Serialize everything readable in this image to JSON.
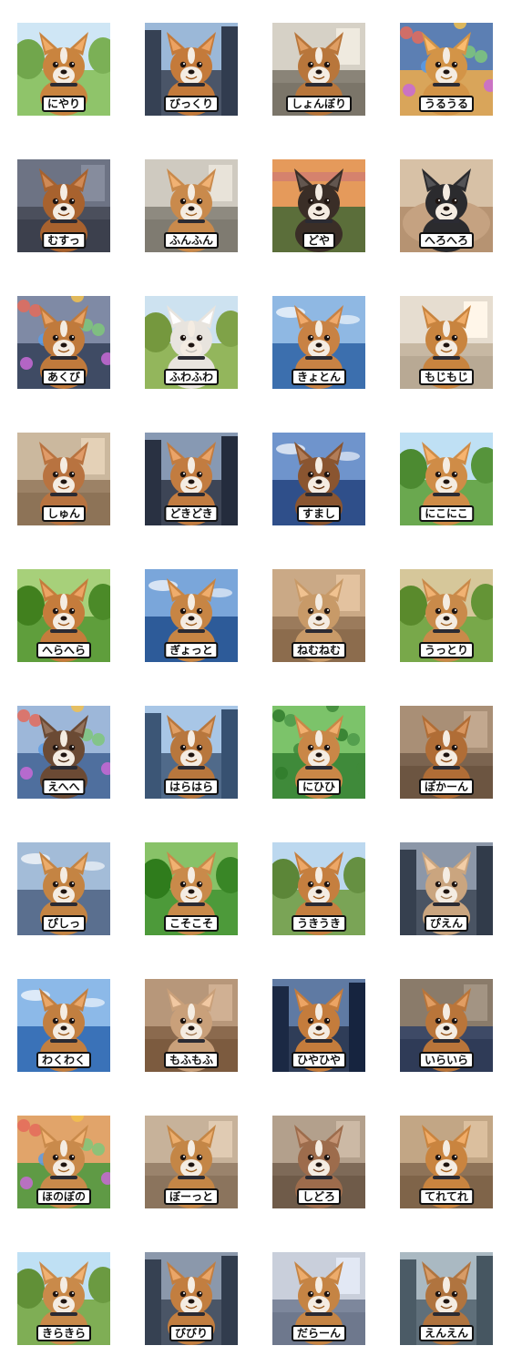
{
  "stickers": [
    {
      "label": "にやり",
      "scene": "park",
      "bg": "#8fc46a",
      "sky": "#cfe6f5",
      "dog": "#c9843f"
    },
    {
      "label": "びっくり",
      "scene": "city",
      "bg": "#4a5568",
      "sky": "#9bb8d8",
      "dog": "#c47a3a"
    },
    {
      "label": "しょんぼり",
      "scene": "room",
      "bg": "#8a8478",
      "sky": "#d6d1c6",
      "dog": "#b8763b"
    },
    {
      "label": "うるうる",
      "scene": "toys",
      "bg": "#d9a55a",
      "sky": "#5c7fb3",
      "dog": "#d39447"
    },
    {
      "label": "むすっ",
      "scene": "sofa",
      "bg": "#4b4f5c",
      "sky": "#6d7384",
      "dog": "#a8622e"
    },
    {
      "label": "ふんふん",
      "scene": "room",
      "bg": "#8e8a80",
      "sky": "#cfcac0",
      "dog": "#c98a4c"
    },
    {
      "label": "どや",
      "scene": "sunset",
      "bg": "#5b6e3a",
      "sky": "#e59a5b",
      "dog": "#3a2e27"
    },
    {
      "label": "へろへろ",
      "scene": "rug",
      "bg": "#b69372",
      "sky": "#d7c1a6",
      "dog": "#2b2b2e"
    },
    {
      "label": "あくび",
      "scene": "crowd",
      "bg": "#3f4b64",
      "sky": "#7f8aa5",
      "dog": "#c07a3c"
    },
    {
      "label": "ふわふわ",
      "scene": "field",
      "bg": "#93b65c",
      "sky": "#cde2f0",
      "dog": "#e8e4de"
    },
    {
      "label": "きょとん",
      "scene": "sky",
      "bg": "#3c6fae",
      "sky": "#8fb8e3",
      "dog": "#c88244"
    },
    {
      "label": "もじもじ",
      "scene": "room",
      "bg": "#c7b8a3",
      "sky": "#e6ddd0",
      "dog": "#c8843f"
    },
    {
      "label": "しゅん",
      "scene": "room",
      "bg": "#9c8266",
      "sky": "#cbb89e",
      "dog": "#b87340"
    },
    {
      "label": "どきどき",
      "scene": "city",
      "bg": "#3d4556",
      "sky": "#8799b3",
      "dog": "#c27c40"
    },
    {
      "label": "すまし",
      "scene": "sky",
      "bg": "#2f4f8a",
      "sky": "#6f94cc",
      "dog": "#8a5530"
    },
    {
      "label": "にこにこ",
      "scene": "park",
      "bg": "#6aa84f",
      "sky": "#bfe0f4",
      "dog": "#cf8c47"
    },
    {
      "label": "へらへら",
      "scene": "field",
      "bg": "#5f9e3c",
      "sky": "#a7d07a",
      "dog": "#c57c3c"
    },
    {
      "label": "ぎょっと",
      "scene": "sky",
      "bg": "#2d5b99",
      "sky": "#7aa6da",
      "dog": "#c78544"
    },
    {
      "label": "ねむねむ",
      "scene": "sofa",
      "bg": "#9b7b5c",
      "sky": "#caa986",
      "dog": "#c89a68"
    },
    {
      "label": "うっとり",
      "scene": "field",
      "bg": "#78a84a",
      "sky": "#d6c79a",
      "dog": "#c98a4a"
    },
    {
      "label": "えへへ",
      "scene": "crowd",
      "bg": "#4f6f9e",
      "sky": "#9db7d9",
      "dog": "#6b4a34"
    },
    {
      "label": "はらはら",
      "scene": "city",
      "bg": "#506a8a",
      "sky": "#a8c6e6",
      "dog": "#b8773d"
    },
    {
      "label": "にひひ",
      "scene": "leaf",
      "bg": "#3f8a3a",
      "sky": "#7cc36a",
      "dog": "#c98747"
    },
    {
      "label": "ぽかーん",
      "scene": "room",
      "bg": "#7b6450",
      "sky": "#a98f76",
      "dog": "#b06d36"
    },
    {
      "label": "ぴしっ",
      "scene": "sky",
      "bg": "#5a6f8f",
      "sky": "#a3bcd8",
      "dog": "#c48443"
    },
    {
      "label": "こそこそ",
      "scene": "grass",
      "bg": "#4d9a3a",
      "sky": "#88c268",
      "dog": "#c98a4a"
    },
    {
      "label": "うきうき",
      "scene": "field",
      "bg": "#7aa456",
      "sky": "#bcd8ef",
      "dog": "#c57f3f"
    },
    {
      "label": "ぴえん",
      "scene": "city",
      "bg": "#4a5463",
      "sky": "#8c97a8",
      "dog": "#caa57f"
    },
    {
      "label": "わくわく",
      "scene": "sky",
      "bg": "#3a72b8",
      "sky": "#8cb9e8",
      "dog": "#c27f40"
    },
    {
      "label": "もふもふ",
      "scene": "room",
      "bg": "#8b6a4e",
      "sky": "#b7977a",
      "dog": "#c9a07a"
    },
    {
      "label": "ひやひや",
      "scene": "city",
      "bg": "#2f3d58",
      "sky": "#5f7aa3",
      "dog": "#c47c3c"
    },
    {
      "label": "いらいら",
      "scene": "sofa",
      "bg": "#3e4a66",
      "sky": "#8a7b6a",
      "dog": "#b9753a"
    },
    {
      "label": "ほのぼの",
      "scene": "flower",
      "bg": "#5f9a45",
      "sky": "#e1a46a",
      "dog": "#c98a4b"
    },
    {
      "label": "ぼーっと",
      "scene": "room",
      "bg": "#9a836c",
      "sky": "#c7b29a",
      "dog": "#c48646"
    },
    {
      "label": "しどろ",
      "scene": "room",
      "bg": "#7e6a58",
      "sky": "#b3a08c",
      "dog": "#9d6c4c"
    },
    {
      "label": "てれてれ",
      "scene": "room",
      "bg": "#8e7358",
      "sky": "#c2a685",
      "dog": "#c9843f"
    },
    {
      "label": "きらきら",
      "scene": "park",
      "bg": "#7fae55",
      "sky": "#bfe0f4",
      "dog": "#c98a4a"
    },
    {
      "label": "びびり",
      "scene": "city",
      "bg": "#4a5566",
      "sky": "#8b98ab",
      "dog": "#c27e40"
    },
    {
      "label": "だらーん",
      "scene": "sofa",
      "bg": "#7d879c",
      "sky": "#c9cfdb",
      "dog": "#c58444"
    },
    {
      "label": "えんえん",
      "scene": "city",
      "bg": "#5f6f7a",
      "sky": "#aab9c2",
      "dog": "#b0743f"
    }
  ]
}
